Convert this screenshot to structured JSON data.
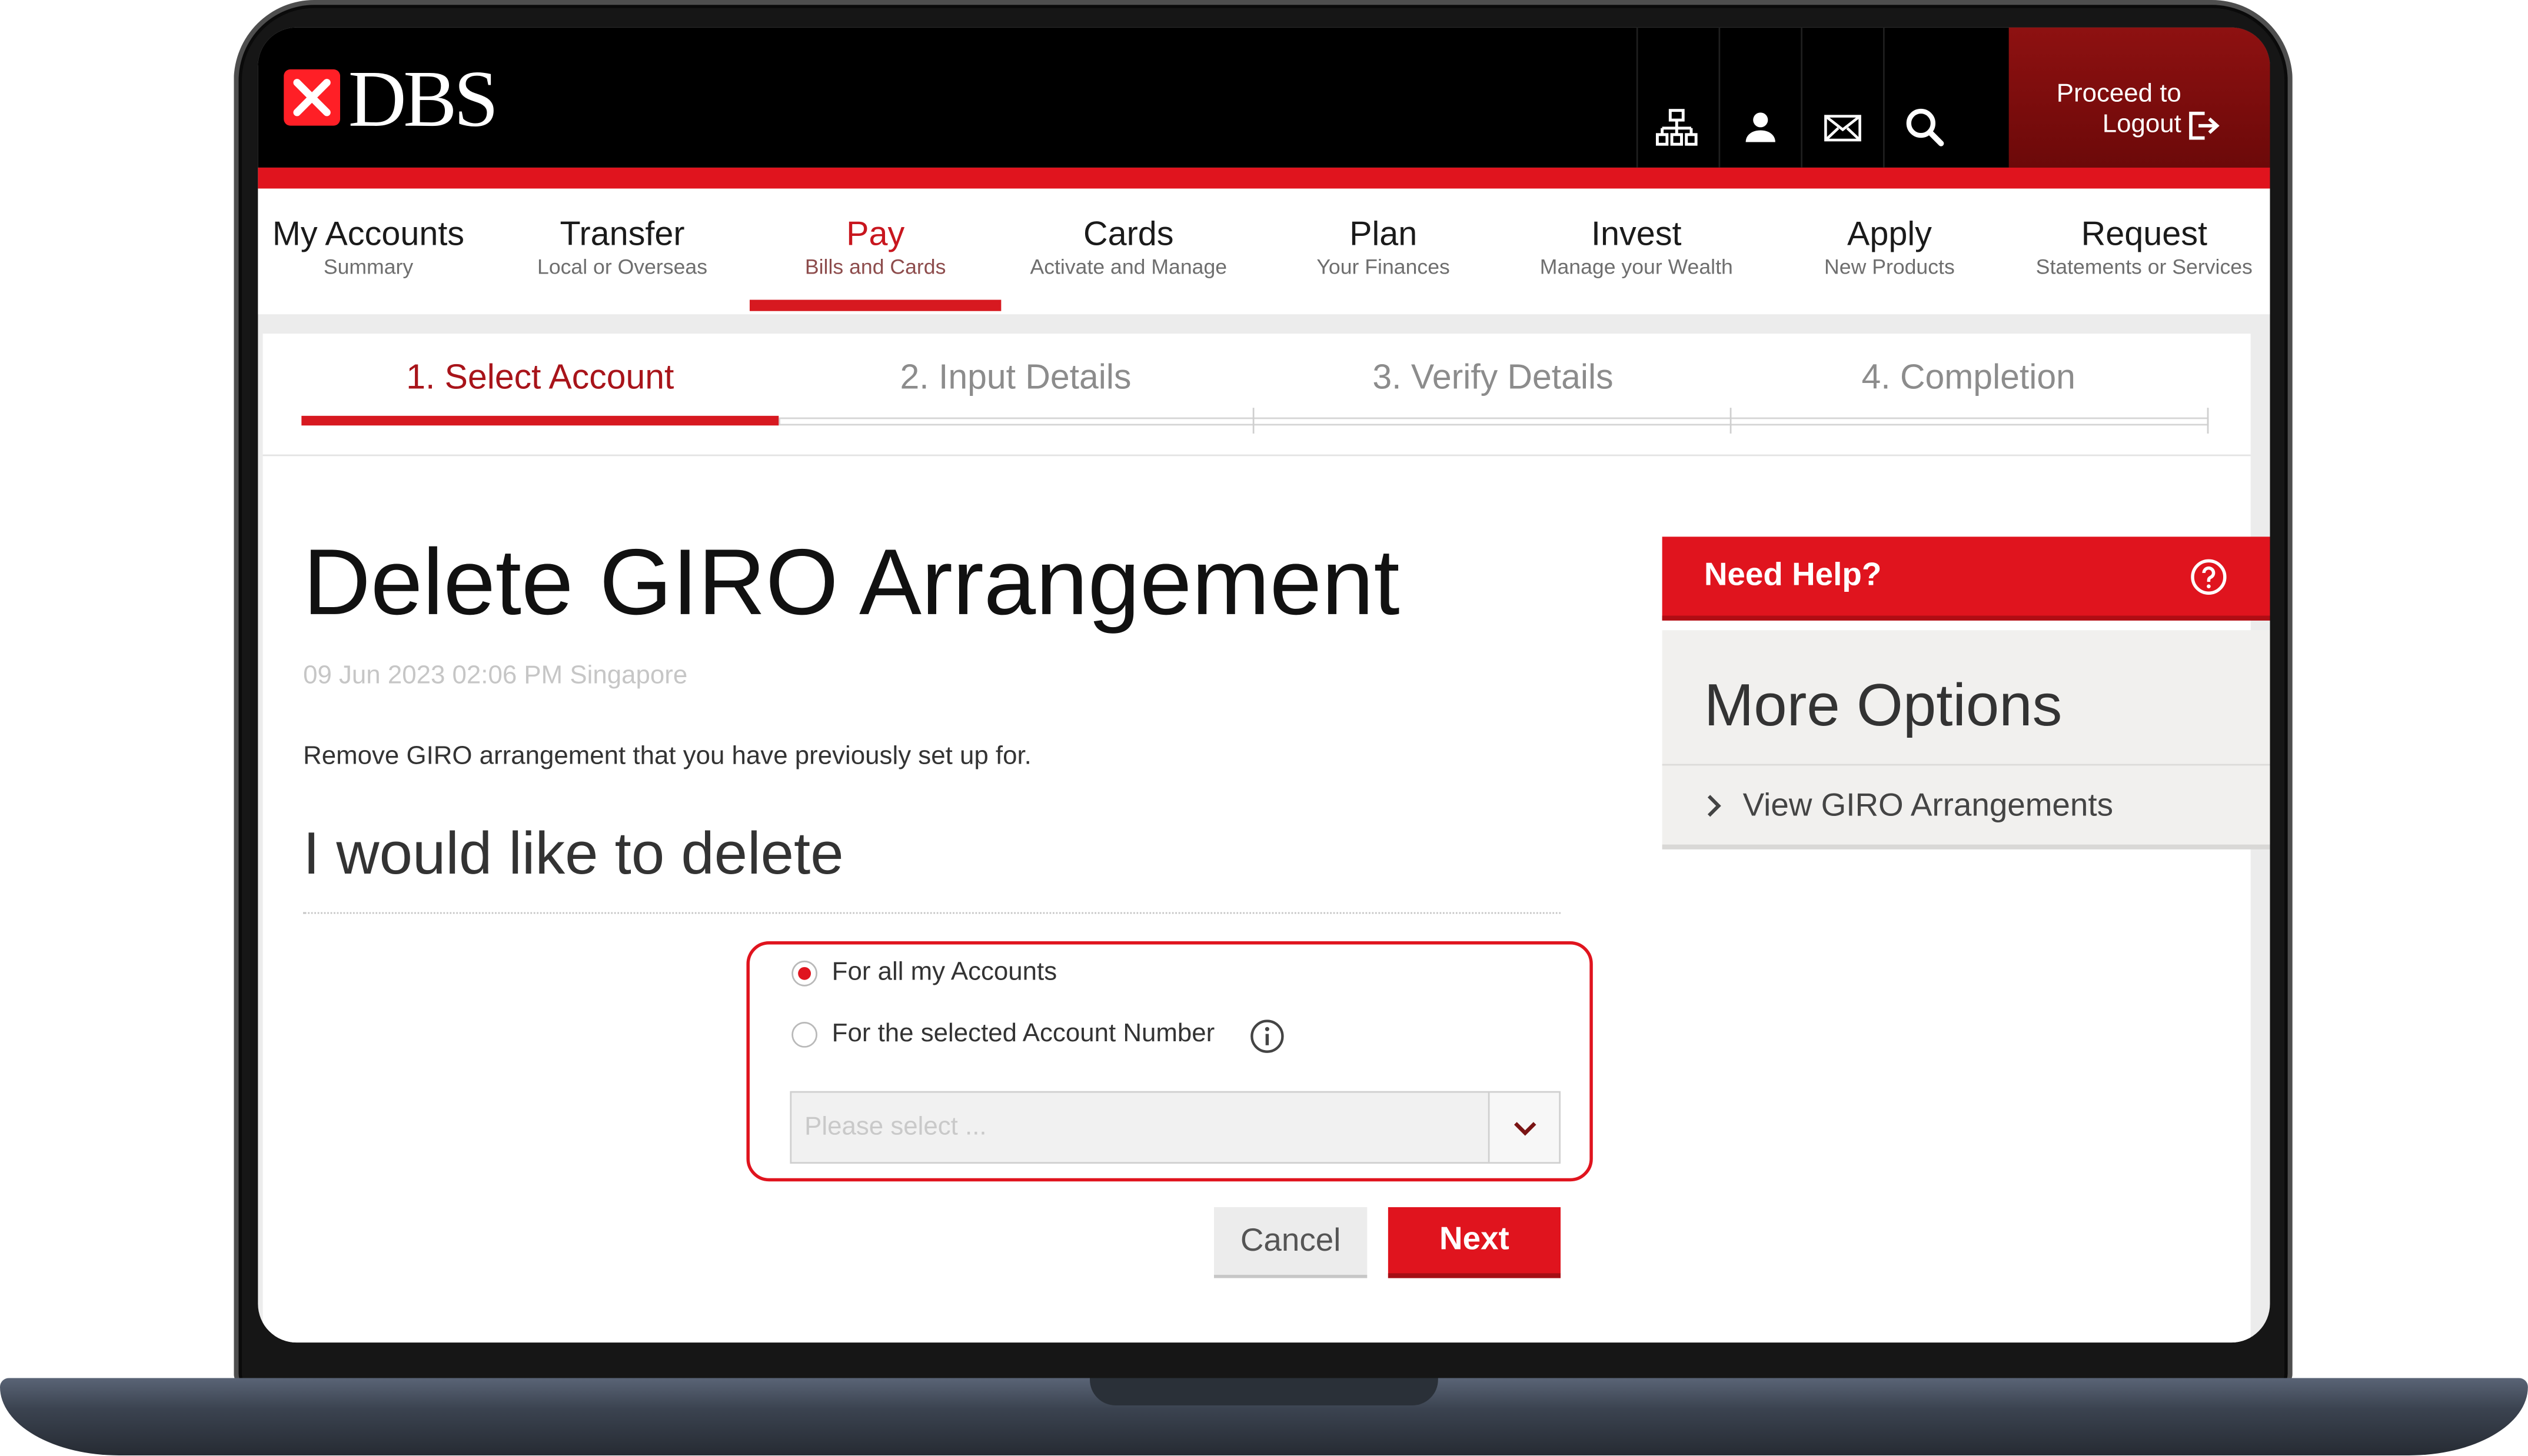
{
  "colors": {
    "brand_red": "#e0141e",
    "header_bg": "#000000",
    "logout_bg": "#7c0b0b",
    "step_active": "#a8141a"
  },
  "header": {
    "logo_icon": "dbs-star-icon",
    "logo_text": "DBS",
    "icons": [
      "sitemap-icon",
      "user-icon",
      "mail-icon",
      "search-icon"
    ],
    "logout_line1": "Proceed to",
    "logout_line2": "Logout",
    "logout_icon": "logout-icon"
  },
  "nav": [
    {
      "label": "My Accounts",
      "sub": "Summary",
      "active": false
    },
    {
      "label": "Transfer",
      "sub": "Local or Overseas",
      "active": false
    },
    {
      "label": "Pay",
      "sub": "Bills and Cards",
      "active": true
    },
    {
      "label": "Cards",
      "sub": "Activate and Manage",
      "active": false
    },
    {
      "label": "Plan",
      "sub": "Your Finances",
      "active": false
    },
    {
      "label": "Invest",
      "sub": "Manage your Wealth",
      "active": false
    },
    {
      "label": "Apply",
      "sub": "New Products",
      "active": false
    },
    {
      "label": "Request",
      "sub": "Statements or Services",
      "active": false
    }
  ],
  "steps": [
    {
      "label": "1. Select Account",
      "active": true
    },
    {
      "label": "2. Input Details",
      "active": false
    },
    {
      "label": "3. Verify Details",
      "active": false
    },
    {
      "label": "4. Completion",
      "active": false
    }
  ],
  "main": {
    "title": "Delete GIRO Arrangement",
    "timestamp": "09 Jun 2023 02:06 PM Singapore",
    "description": "Remove GIRO arrangement that you have previously set up for.",
    "section_heading": "I would like to delete",
    "options": [
      {
        "label": "For all my Accounts",
        "selected": true
      },
      {
        "label": "For the selected Account Number",
        "selected": false
      }
    ],
    "account_select": {
      "placeholder": "Please select ..."
    },
    "cancel_label": "Cancel",
    "next_label": "Next"
  },
  "sidebar": {
    "help_label": "Need Help?",
    "help_icon": "question-circle-icon",
    "more_options_title": "More Options",
    "links": [
      {
        "label": "View GIRO Arrangements"
      }
    ]
  }
}
